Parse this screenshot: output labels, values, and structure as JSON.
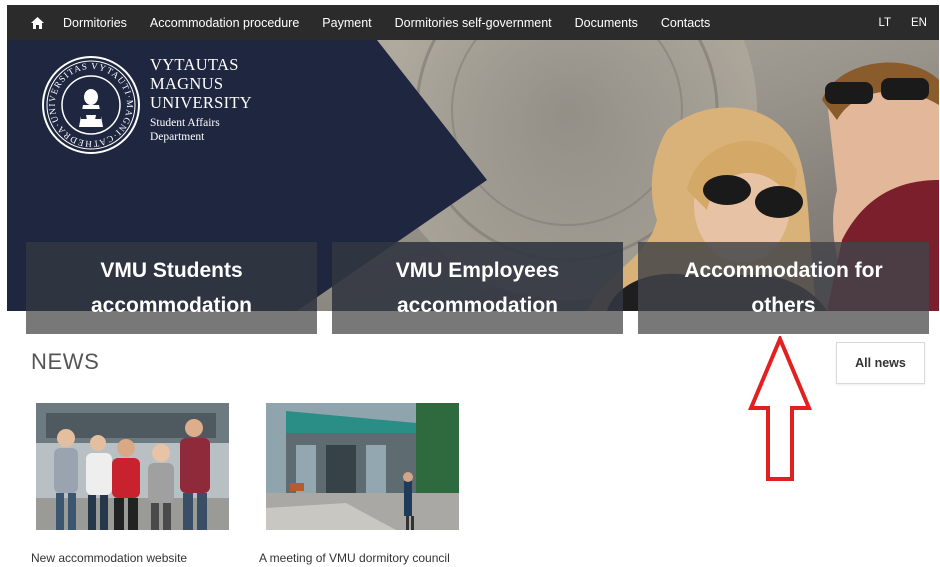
{
  "nav": {
    "home_icon": "home-icon",
    "items": [
      {
        "label": "Dormitories"
      },
      {
        "label": "Accommodation procedure"
      },
      {
        "label": "Payment"
      },
      {
        "label": "Dormitories self-government"
      },
      {
        "label": "Documents"
      },
      {
        "label": "Contacts"
      }
    ],
    "lang": [
      "LT",
      "EN"
    ]
  },
  "logo": {
    "line1": "VYTAUTAS",
    "line2": "MAGNUS",
    "line3": "UNIVERSITY",
    "line4": "Student Affairs",
    "line5": "Department",
    "seal_ring_text": "VYTAUTI·MAGNI·CATHEDRA·UNIVERSITAS"
  },
  "cards": [
    {
      "label": "VMU Students accommodation"
    },
    {
      "label": "VMU Employees accommodation"
    },
    {
      "label": "Accommodation for others"
    }
  ],
  "news": {
    "title": "NEWS",
    "all_label": "All news",
    "items": [
      {
        "caption": "New accommodation website"
      },
      {
        "caption": "A meeting of VMU dormitory council"
      }
    ]
  },
  "colors": {
    "nav_bg": "#2b2b2b",
    "hero_navy": "#1f2640",
    "arrow_red": "#e32020"
  }
}
